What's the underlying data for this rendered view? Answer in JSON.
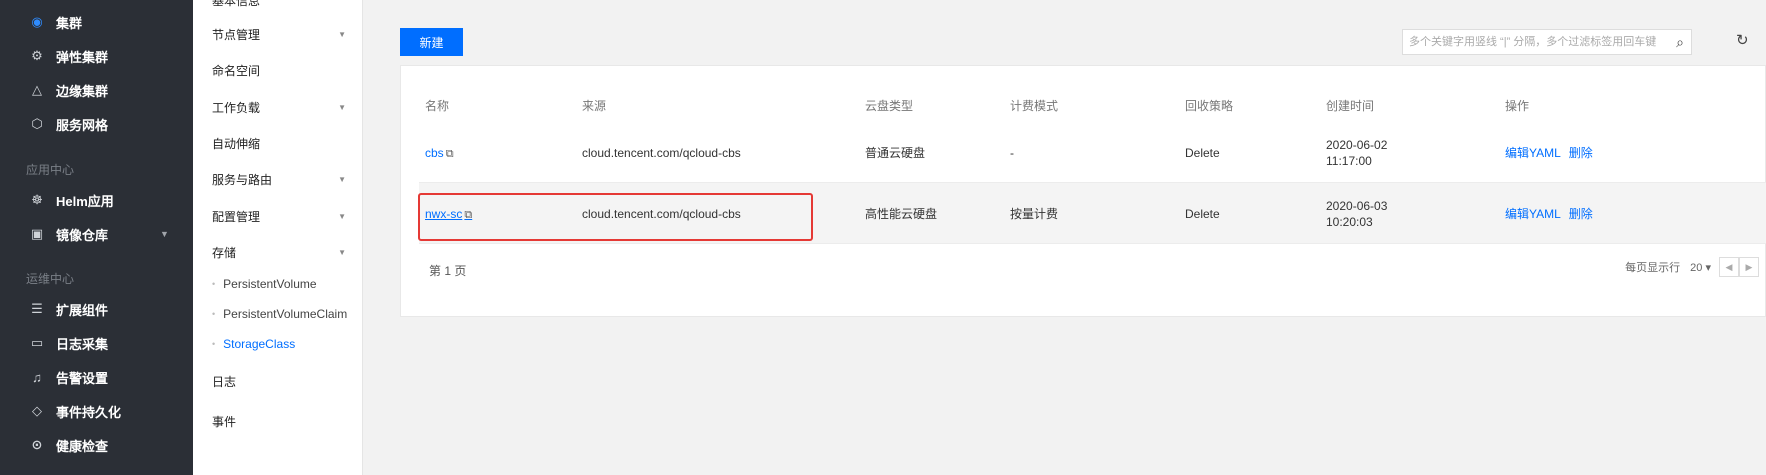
{
  "sidebar": {
    "items": [
      {
        "label": "集群",
        "icon": "cluster-icon",
        "active": true
      },
      {
        "label": "弹性集群",
        "icon": "elastic-cluster-icon"
      },
      {
        "label": "边缘集群",
        "icon": "edge-cluster-icon"
      },
      {
        "label": "服务网格",
        "icon": "service-mesh-icon"
      }
    ],
    "group_app": "应用中心",
    "app_items": [
      {
        "label": "Helm应用",
        "icon": "helm-icon"
      },
      {
        "label": "镜像仓库",
        "icon": "registry-icon"
      }
    ],
    "group_ops": "运维中心",
    "ops_items": [
      {
        "label": "扩展组件",
        "icon": "addon-icon"
      },
      {
        "label": "日志采集",
        "icon": "log-icon"
      },
      {
        "label": "告警设置",
        "icon": "alarm-icon"
      },
      {
        "label": "事件持久化",
        "icon": "event-icon"
      },
      {
        "label": "健康检查",
        "icon": "health-icon"
      }
    ]
  },
  "submenu": {
    "top_cut": "基本信息",
    "items": [
      "节点管理",
      "命名空间",
      "工作负载",
      "自动伸缩",
      "服务与路由",
      "配置管理",
      "存储"
    ],
    "storage_children": [
      "PersistentVolume",
      "PersistentVolumeClaim",
      "StorageClass"
    ],
    "tail_items": [
      "日志",
      "事件"
    ]
  },
  "toolbar": {
    "new_label": "新建",
    "search_placeholder": "多个关键字用竖线 “|” 分隔，多个过滤标签用回车键"
  },
  "table": {
    "headers": [
      "名称",
      "来源",
      "云盘类型",
      "计费模式",
      "回收策略",
      "创建时间",
      "操作"
    ],
    "rows": [
      {
        "name": "cbs",
        "source": "cloud.tencent.com/qcloud-cbs",
        "disk_type": "普通云硬盘",
        "billing": "-",
        "reclaim": "Delete",
        "date": "2020-06-02",
        "time": "11:17:00",
        "op_edit": "编辑YAML",
        "op_delete": "删除"
      },
      {
        "name": "nwx-sc",
        "source": "cloud.tencent.com/qcloud-cbs",
        "disk_type": "高性能云硬盘",
        "billing": "按量计费",
        "reclaim": "Delete",
        "date": "2020-06-03",
        "time": "10:20:03",
        "op_edit": "编辑YAML",
        "op_delete": "删除"
      }
    ]
  },
  "pagination": {
    "page_label": "第 1 页",
    "per_page_label": "每页显示行",
    "per_page_value": "20 ▾"
  },
  "colors": {
    "accent": "#006eff",
    "sidebar_bg": "#2b2f36",
    "highlight": "#e53935"
  }
}
